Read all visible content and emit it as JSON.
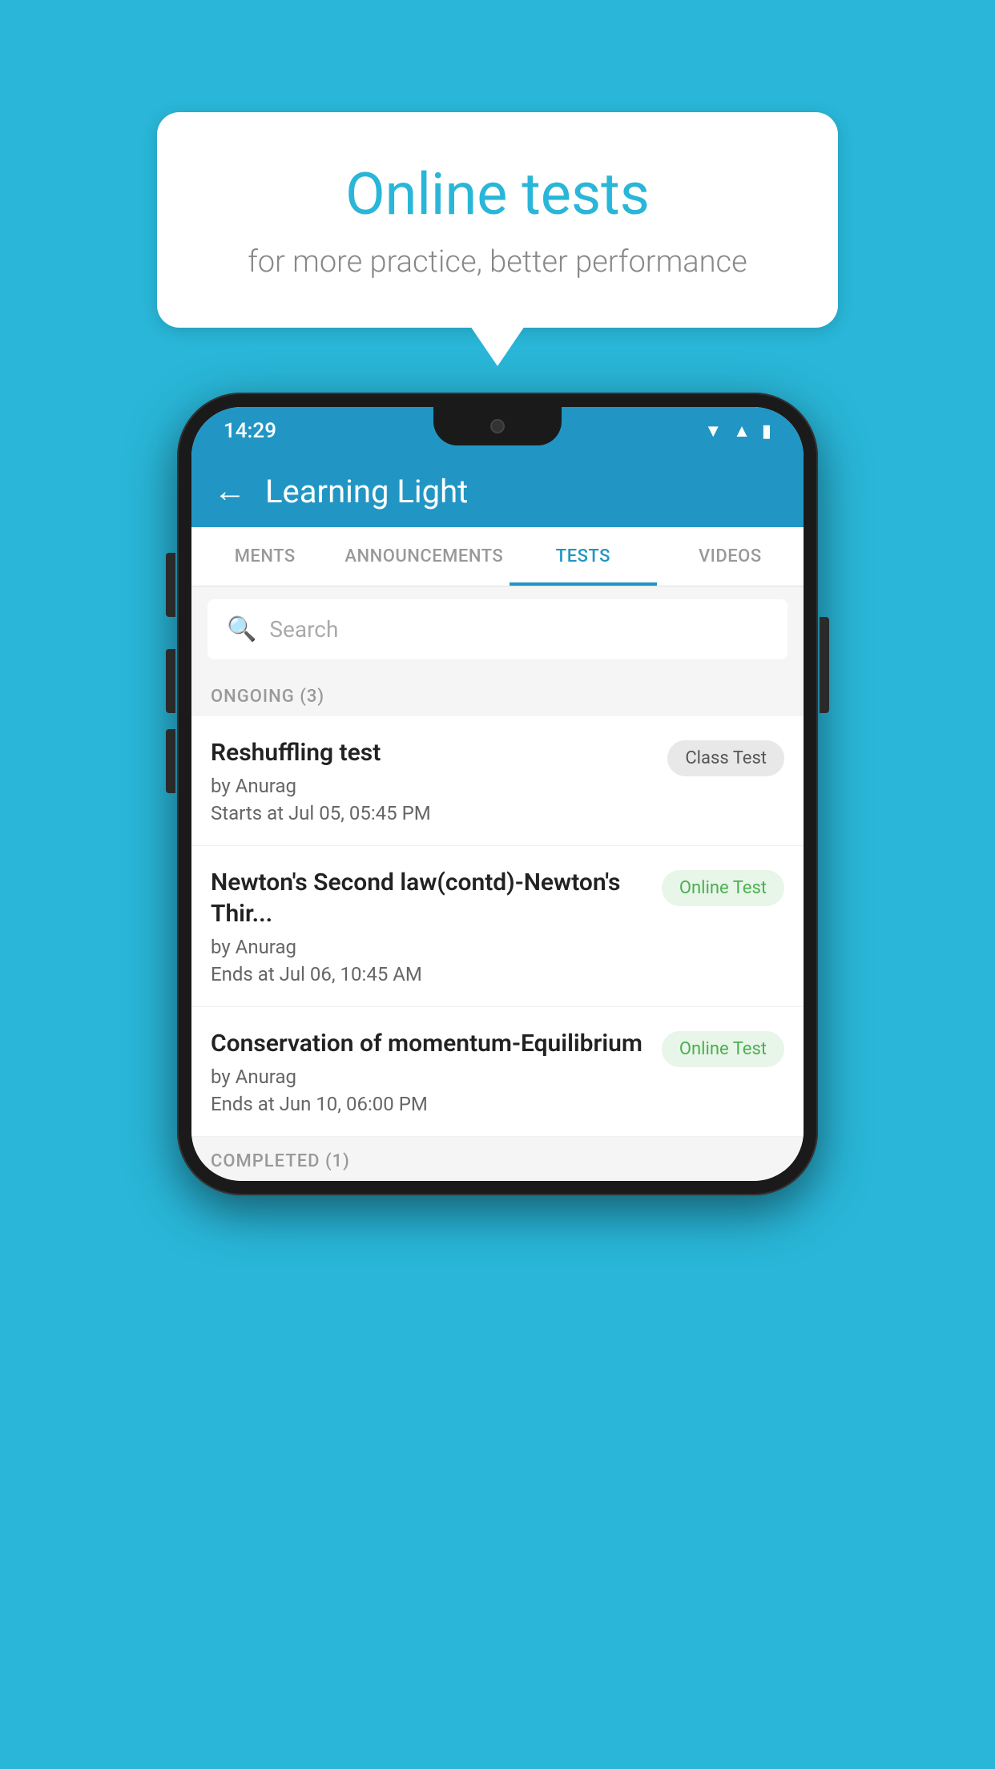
{
  "background": {
    "color": "#29b6d8"
  },
  "speech_bubble": {
    "title": "Online tests",
    "subtitle": "for more practice, better performance"
  },
  "phone": {
    "status_bar": {
      "time": "14:29",
      "icons": [
        "wifi",
        "signal",
        "battery"
      ]
    },
    "header": {
      "title": "Learning Light",
      "back_label": "←"
    },
    "tabs": [
      {
        "label": "MENTS",
        "active": false
      },
      {
        "label": "ANNOUNCEMENTS",
        "active": false
      },
      {
        "label": "TESTS",
        "active": true
      },
      {
        "label": "VIDEOS",
        "active": false
      }
    ],
    "search": {
      "placeholder": "Search"
    },
    "ongoing_section": {
      "label": "ONGOING (3)"
    },
    "tests": [
      {
        "title": "Reshuffling test",
        "author": "by Anurag",
        "date_label": "Starts at",
        "date": "Jul 05, 05:45 PM",
        "badge": "Class Test",
        "badge_type": "class"
      },
      {
        "title": "Newton's Second law(contd)-Newton's Thir...",
        "author": "by Anurag",
        "date_label": "Ends at",
        "date": "Jul 06, 10:45 AM",
        "badge": "Online Test",
        "badge_type": "online"
      },
      {
        "title": "Conservation of momentum-Equilibrium",
        "author": "by Anurag",
        "date_label": "Ends at",
        "date": "Jun 10, 06:00 PM",
        "badge": "Online Test",
        "badge_type": "online"
      }
    ],
    "completed_section": {
      "label": "COMPLETED (1)"
    }
  }
}
